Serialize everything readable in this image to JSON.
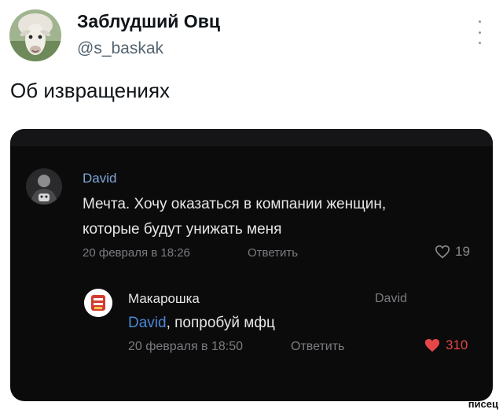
{
  "tweet": {
    "author": {
      "name": "Заблудший Овц",
      "handle": "@s_baskak"
    },
    "text": "Об извращениях",
    "colors": {
      "name": "#0f1419",
      "handle": "#536471",
      "more_icon": "#8b98a5"
    }
  },
  "embedded_screenshot": {
    "background": "#0b0b0c",
    "comments": [
      {
        "author": "David",
        "text_line1": "Мечта. Хочу оказаться в компании женщин,",
        "text_line2": "которые будут унижать меня",
        "date": "20 февраля в 18:26",
        "reply_label": "Ответить",
        "likes": "19",
        "like_icon": "heart-outline-icon"
      },
      {
        "author": "Макарошка",
        "reply_to": "David",
        "mention": "David",
        "text": ", попробуй мфц",
        "date": "20 февраля в 18:50",
        "reply_label": "Ответить",
        "likes": "310",
        "like_icon": "heart-filled-icon",
        "like_color": "#e64646"
      }
    ]
  },
  "watermark": "писец"
}
